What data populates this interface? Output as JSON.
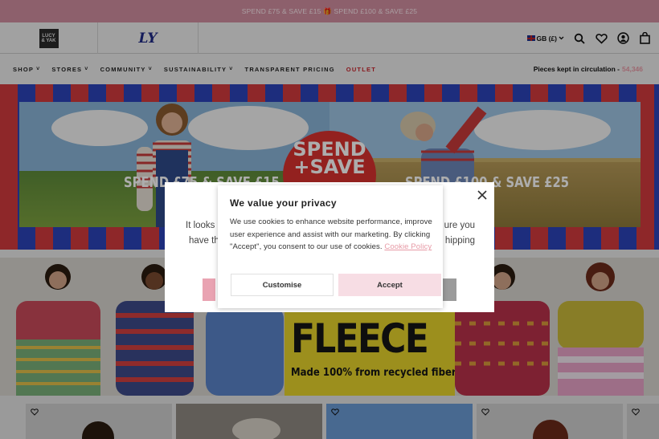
{
  "announcement": {
    "text": "SPEND £75 & SAVE £15 🎁 SPEND £100 & SAVE £25"
  },
  "header": {
    "brand_mark": [
      "LUCY",
      "& YAK"
    ],
    "script_logo": "LY",
    "locale": "GB (£)"
  },
  "nav": {
    "items": [
      {
        "label": "SHOP",
        "chevron": "˅"
      },
      {
        "label": "STORES",
        "chevron": "˅"
      },
      {
        "label": "COMMUNITY",
        "chevron": "˅"
      },
      {
        "label": "SUSTAINABILITY",
        "chevron": "˅"
      },
      {
        "label": "TRANSPARENT PRICING",
        "chevron": ""
      },
      {
        "label": "OUTLET",
        "chevron": ""
      }
    ],
    "pieces_label": "Pieces kept in circulation -",
    "pieces_value": "54,346"
  },
  "hero": {
    "left_text": "SPEND £75 & SAVE £15",
    "right_text": "SPEND £100 & SAVE £25",
    "badge_line1": "SPEND",
    "badge_line2": "+SAVE"
  },
  "fleece": {
    "headline": "FLEECE",
    "subline": "Made 100% from recycled fibers"
  },
  "region_modal": {
    "text_line1": "It looks",
    "text_line1_end": "ure you",
    "text_line2": "have th",
    "text_line2_end": "hipping"
  },
  "cookie": {
    "title": "We value your privacy",
    "body": "We use cookies to enhance website performance, improve user experience and assist with our marketing. By clicking \"Accept\", you consent to our use of cookies.",
    "link": "Cookie Policy",
    "customise": "Customise",
    "accept": "Accept"
  },
  "colors": {
    "announcement_bg": "#d08ea0",
    "outlet": "#c8222a",
    "accent_pink": "#e79aa6",
    "hero_red": "#d13a3d",
    "hero_blue": "#2c43b9",
    "accept_bg": "#f7dde4"
  }
}
